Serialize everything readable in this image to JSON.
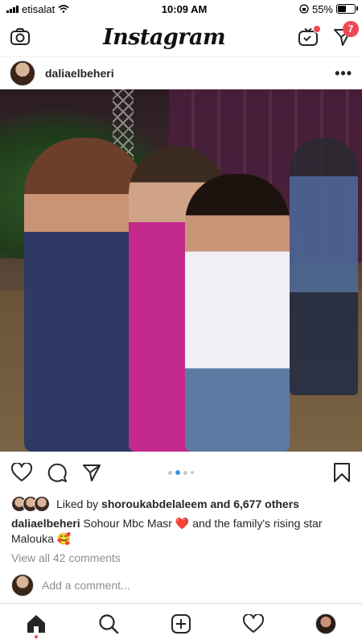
{
  "status_bar": {
    "carrier": "etisalat",
    "time": "10:09 AM",
    "battery_percent": "55%",
    "battery_level": 0.55
  },
  "topbar": {
    "logo": "Instagram",
    "notification_count": "7"
  },
  "post": {
    "username": "daliaelbeheri",
    "more_label": "•••",
    "carousel_active_index": 1,
    "carousel_count": 4,
    "liked_by_prefix": "Liked by",
    "liked_by_user": "shoroukabdelaleem",
    "liked_by_suffix": "and 6,677 others",
    "caption_user": "daliaelbeheri",
    "caption_text_1": "Sohour Mbc Masr",
    "caption_emoji_heart": "❤️",
    "caption_text_2": "and the family's rising star Malouka",
    "caption_emoji_2": "🥰",
    "view_comments": "View all 42 comments",
    "add_comment_placeholder": "Add a comment..."
  },
  "colors": {
    "accent_blue": "#3897f0",
    "notification_red": "#ed4956",
    "muted_text": "#8e8e8e"
  },
  "icons": {
    "topbar": [
      "camera-icon",
      "igtv-icon",
      "direct-message-icon"
    ],
    "actions": [
      "heart-icon",
      "comment-icon",
      "share-icon",
      "bookmark-icon"
    ],
    "tabbar": [
      "home-icon",
      "search-icon",
      "add-post-icon",
      "activity-heart-icon",
      "profile-avatar"
    ]
  }
}
